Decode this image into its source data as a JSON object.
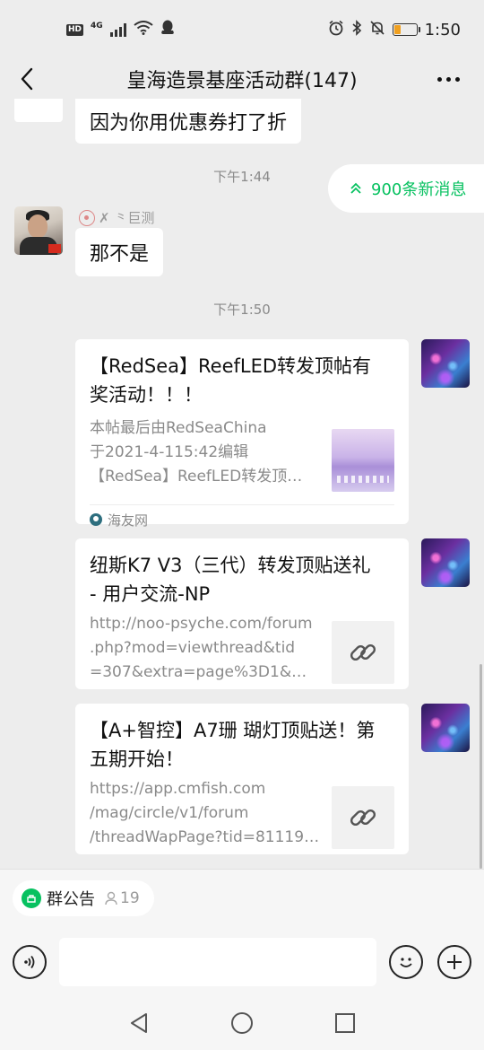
{
  "status_bar": {
    "network_badge": "HD",
    "network_type": "4G",
    "time": "1:50",
    "battery_level": 0.3,
    "battery_color": "#f0a020"
  },
  "header": {
    "title": "皇海造景基座活动群(147)"
  },
  "chat": {
    "messages": [
      {
        "type": "text",
        "text": "因为你用优惠券打了折"
      },
      {
        "type": "timestamp",
        "text": "下午1:44"
      },
      {
        "type": "text",
        "sender": "✗ ⺀巨测",
        "text": "那不是"
      },
      {
        "type": "timestamp",
        "text": "下午1:50"
      }
    ],
    "new_messages_pill": "900条新消息",
    "cards": [
      {
        "title": "【RedSea】ReefLED转发顶帖有奖活动！！！",
        "title_lines": [
          "【RedSea】ReefLED转发顶帖有",
          "奖活动！！！"
        ],
        "desc_lines": [
          "本帖最后由RedSeaChina",
          "于2021-4-115:42编辑",
          "【RedSea】ReefLED转发顶…"
        ],
        "source": "海友网",
        "thumb": "tank-photo"
      },
      {
        "title_lines": [
          "纽斯K7 V3（三代）转发顶贴送礼",
          "- 用户交流-NP"
        ],
        "desc_lines": [
          "http://noo-psyche.com/forum",
          ".php?mod=viewthread&tid",
          "=307&extra=page%3D1&mo…"
        ],
        "thumb": "link-icon"
      },
      {
        "title_lines": [
          "【A+智控】A7珊 瑚灯顶贴送！第",
          "五期开始！"
        ],
        "desc_lines": [
          "https://app.cmfish.com",
          "/mag/circle/v1/forum",
          "/threadWapPage?tid=81119…"
        ],
        "thumb": "link-icon"
      }
    ]
  },
  "bottom": {
    "notice_label": "群公告",
    "notice_count": "19",
    "input_value": "",
    "accent_color": "#07c160"
  }
}
